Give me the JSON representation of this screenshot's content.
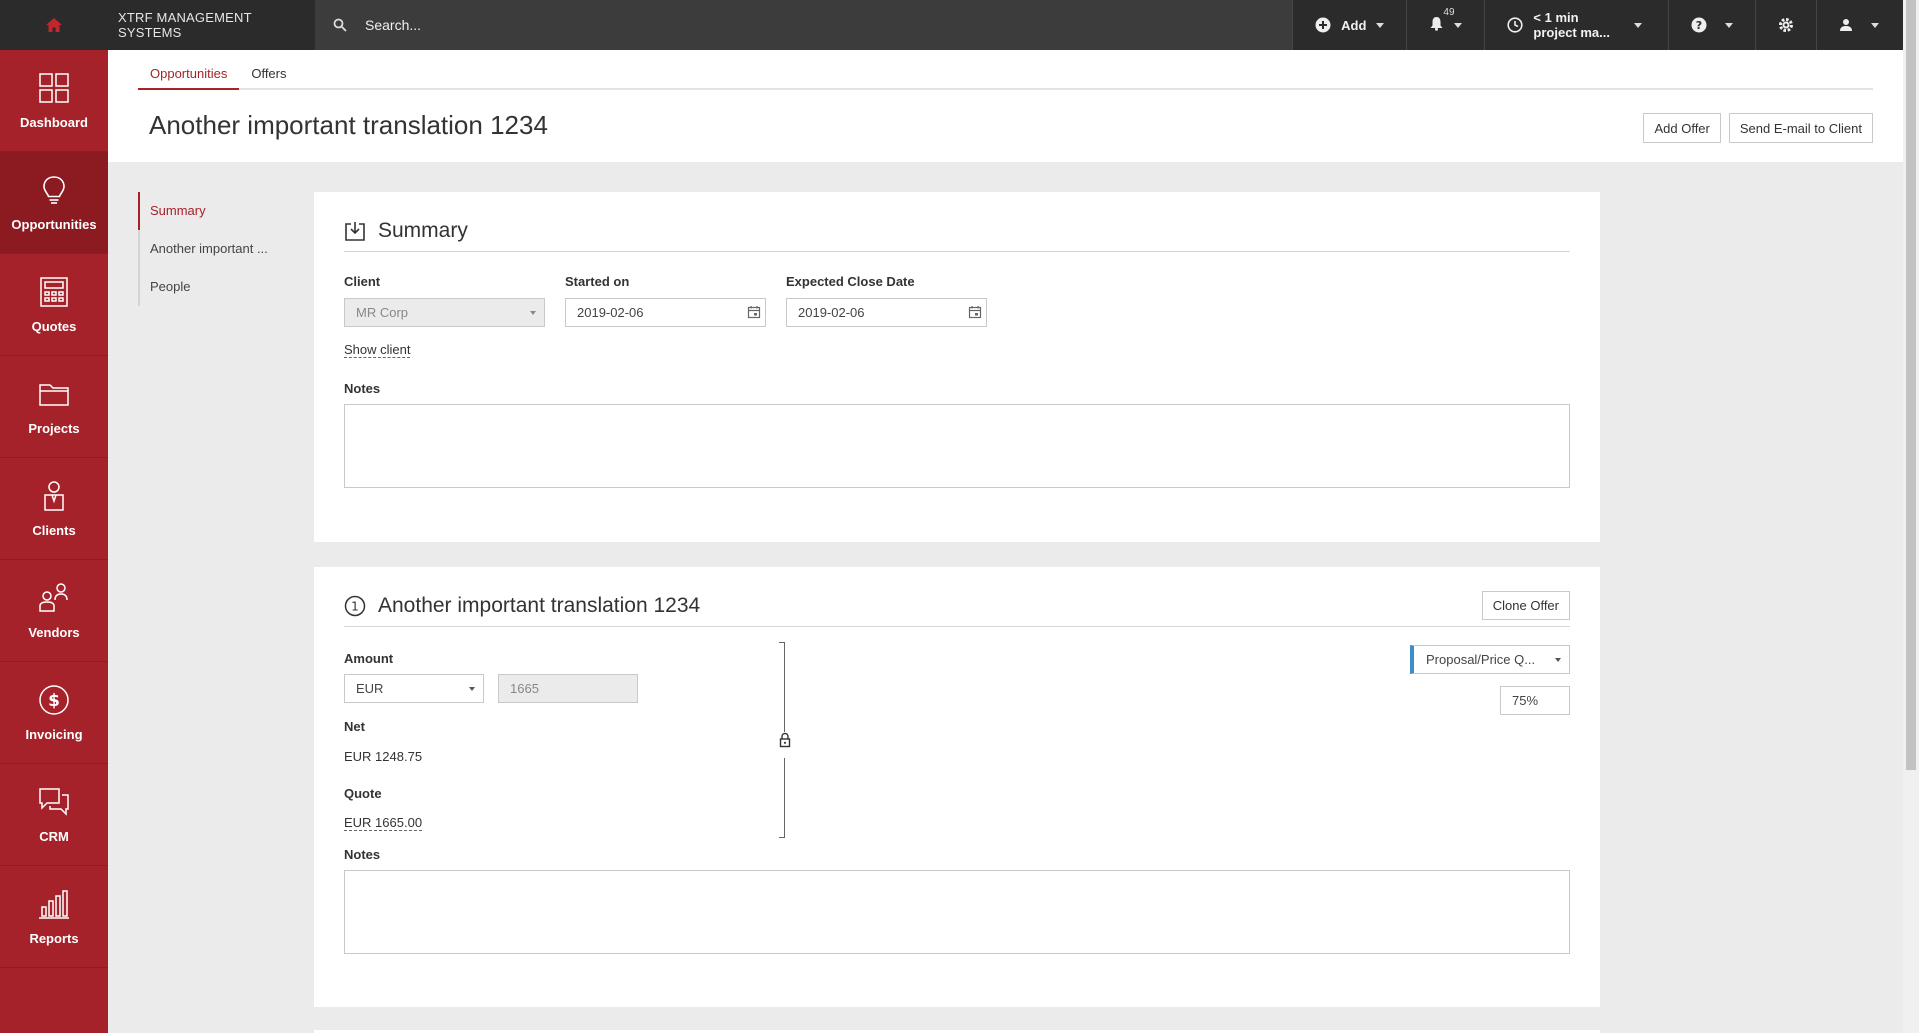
{
  "topbar": {
    "brand": "XTRF MANAGEMENT SYSTEMS",
    "search_placeholder": "Search...",
    "add_label": "Add",
    "notification_count": "49",
    "time_line1": "< 1 min",
    "time_line2": "project ma..."
  },
  "sidebar": {
    "items": [
      {
        "label": "Dashboard",
        "icon": "dashboard-icon"
      },
      {
        "label": "Opportunities",
        "icon": "lightbulb-icon"
      },
      {
        "label": "Quotes",
        "icon": "calculator-icon"
      },
      {
        "label": "Projects",
        "icon": "folder-icon"
      },
      {
        "label": "Clients",
        "icon": "client-icon"
      },
      {
        "label": "Vendors",
        "icon": "vendors-icon"
      },
      {
        "label": "Invoicing",
        "icon": "dollar-icon"
      },
      {
        "label": "CRM",
        "icon": "chat-icon"
      },
      {
        "label": "Reports",
        "icon": "bar-chart-icon"
      }
    ]
  },
  "header": {
    "tabs": [
      "Opportunities",
      "Offers"
    ],
    "title": "Another important translation 1234",
    "add_offer": "Add Offer",
    "send_email": "Send E-mail to Client"
  },
  "subnav": {
    "items": [
      "Summary",
      "Another important ...",
      "People"
    ]
  },
  "summary": {
    "heading": "Summary",
    "client_label": "Client",
    "client_value": "MR Corp",
    "started_label": "Started on",
    "started_value": "2019-02-06",
    "close_label": "Expected Close Date",
    "close_value": "2019-02-06",
    "show_client": "Show client",
    "notes_label": "Notes"
  },
  "offer": {
    "number": "1",
    "heading": "Another important translation 1234",
    "clone_label": "Clone Offer",
    "amount_label": "Amount",
    "currency": "EUR",
    "amount_value": "1665",
    "net_label": "Net",
    "net_value": "EUR 1248.75",
    "quote_label": "Quote",
    "quote_value": "EUR 1665.00",
    "status": "Proposal/Price Q...",
    "probability": "75%",
    "notes_label": "Notes"
  },
  "colors": {
    "brand_red": "#a6222a",
    "topbar": "#3c3c3c",
    "status_accent": "#3a8fc8"
  }
}
